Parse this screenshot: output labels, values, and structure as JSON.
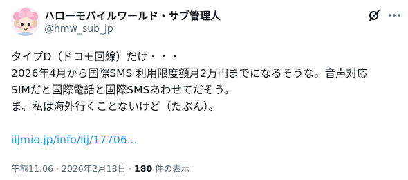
{
  "author": {
    "display_name": "ハローモバイルワールド・サブ管理人",
    "handle": "@hmw_sub_jp"
  },
  "post": {
    "lines": [
      "タイプD（ドコモ回線）だけ・・・",
      "2026年4月から国際SMS 利用限度額月2万円までになるそうな。音声対応",
      "SIMだと国際電話と国際SMSあわせてだそう。",
      "ま、私は海外行くことないけど（たぶん）。"
    ],
    "link_text": "iijmio.jp/info/iij/17706..."
  },
  "meta": {
    "time": "午前11:06",
    "separator": " · ",
    "date": "2026年2月18日",
    "views_count": "180",
    "views_suffix": " 件の表示"
  },
  "icons": {
    "avatar": "pink-sheep-avatar-icon",
    "grok": "grok-icon",
    "more": "more-options-icon"
  },
  "colors": {
    "text": "#0f1419",
    "secondary": "#536471",
    "link": "#1d9bf0"
  }
}
